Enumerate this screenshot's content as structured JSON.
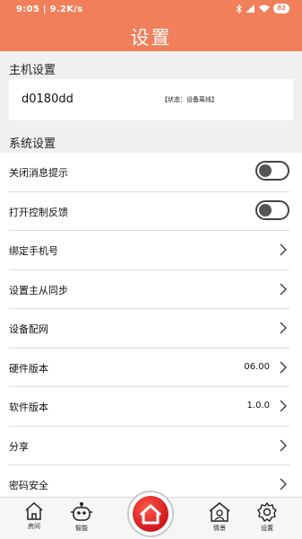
{
  "status_bar": {
    "time": "9:05",
    "network_speed": "9.2K/s",
    "battery": "82"
  },
  "header": {
    "title": "设置"
  },
  "host_section": {
    "label": "主机设置",
    "device_id": "d0180dd",
    "status": "【状态：设备离线】"
  },
  "system_section": {
    "label": "系统设置",
    "items": [
      {
        "label": "关闭消息提示",
        "control": "toggle",
        "on": false
      },
      {
        "label": "打开控制反馈",
        "control": "toggle",
        "on": false
      },
      {
        "label": "绑定手机号",
        "control": "chevron"
      },
      {
        "label": "设置主从同步",
        "control": "chevron"
      },
      {
        "label": "设备配网",
        "control": "chevron"
      },
      {
        "label": "硬件版本",
        "value": "06.00",
        "control": "chevron"
      },
      {
        "label": "软件版本",
        "value": "1.0.0",
        "control": "chevron"
      },
      {
        "label": "分享",
        "control": "chevron"
      },
      {
        "label": "密码安全",
        "control": "chevron"
      }
    ]
  },
  "tab_bar": {
    "tabs": [
      {
        "label": "房间",
        "icon": "house-icon"
      },
      {
        "label": "智能",
        "icon": "robot-icon"
      },
      {
        "label": "",
        "icon": "home-center-icon"
      },
      {
        "label": "情景",
        "icon": "scene-icon"
      },
      {
        "label": "设置",
        "icon": "gear-icon"
      }
    ]
  },
  "colors": {
    "accent": "#f07f5a",
    "home_button": "#d0161a"
  }
}
